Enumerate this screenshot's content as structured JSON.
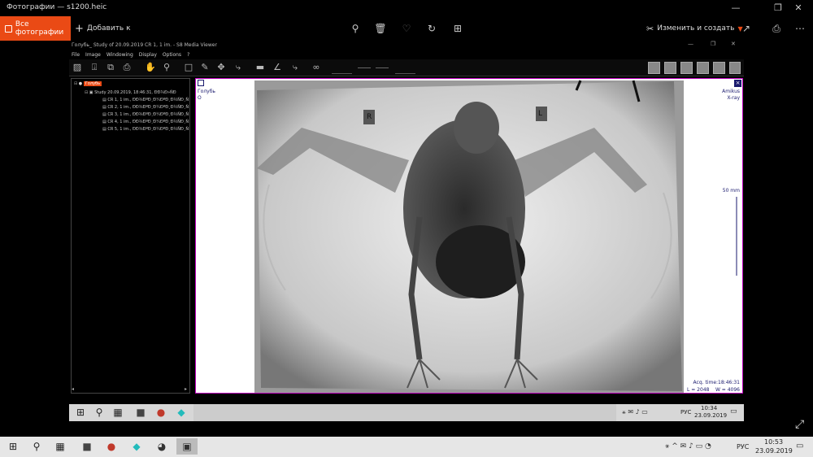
{
  "window": {
    "title": "Фотографии — s1200.heic",
    "controls": [
      "—",
      "❐",
      "✕"
    ]
  },
  "photos_toolbar": {
    "all_photos": "Все фотографии",
    "add_to": "Добавить к",
    "edit_create": "Изменить и создать",
    "icons": [
      "zoom-icon",
      "delete-icon",
      "favorite-icon",
      "rotate-icon",
      "crop-icon",
      "share-icon",
      "print-icon",
      "more-icon"
    ]
  },
  "viewer_app": {
    "title": "Голубь_ Study of 20.09.2019 CR 1, 1 im. - S8 Media Viewer",
    "menu": [
      "File",
      "Image",
      "Windowing",
      "Display",
      "Options",
      "?"
    ],
    "tree": {
      "root": "Голубь",
      "study": "Study 20.09.2019, 18:46:31, ÐÐ¾Ð»ÑÐ",
      "series": [
        "CR 1, 1 im., ÐÐ¾ÐºÐ¸Ð¼ÐºÐ¸Ð½ÑÐ¸Ñ",
        "CR 2, 1 im., ÐÐ¾ÐºÐ¸Ð¼ÐºÐ¸Ð½ÑÐ¸Ñ",
        "CR 3, 1 im., ÐÐ¾ÐºÐ¸Ð¼ÐºÐ¸Ð½ÑÐ¸Ñ",
        "CR 4, 1 im., ÐÐ¾ÐºÐ¸Ð¼ÐºÐ¸Ð½ÑÐ¸Ñ",
        "CR 5, 1 im., ÐÐ¾ÐºÐ¸Ð¼ÐºÐ¸Ð½ÑÐ¸Ñ"
      ]
    },
    "overlay": {
      "top_left_name": "Голубь",
      "top_left_sub": "O",
      "marker_r": "R",
      "marker_l": "L",
      "top_right_1": "Amikus",
      "top_right_2": "X-ray",
      "scale_label": "50 mm",
      "acq_time": "Acq. time:18:46:31",
      "window_level": "L = 2048",
      "window_width": "W = 4096"
    }
  },
  "inner_taskbar": {
    "lang": "РУС",
    "time": "10:34",
    "date": "23.09.2019"
  },
  "main_taskbar": {
    "lang": "РУС",
    "time": "10:53",
    "date": "23.09.2019"
  }
}
